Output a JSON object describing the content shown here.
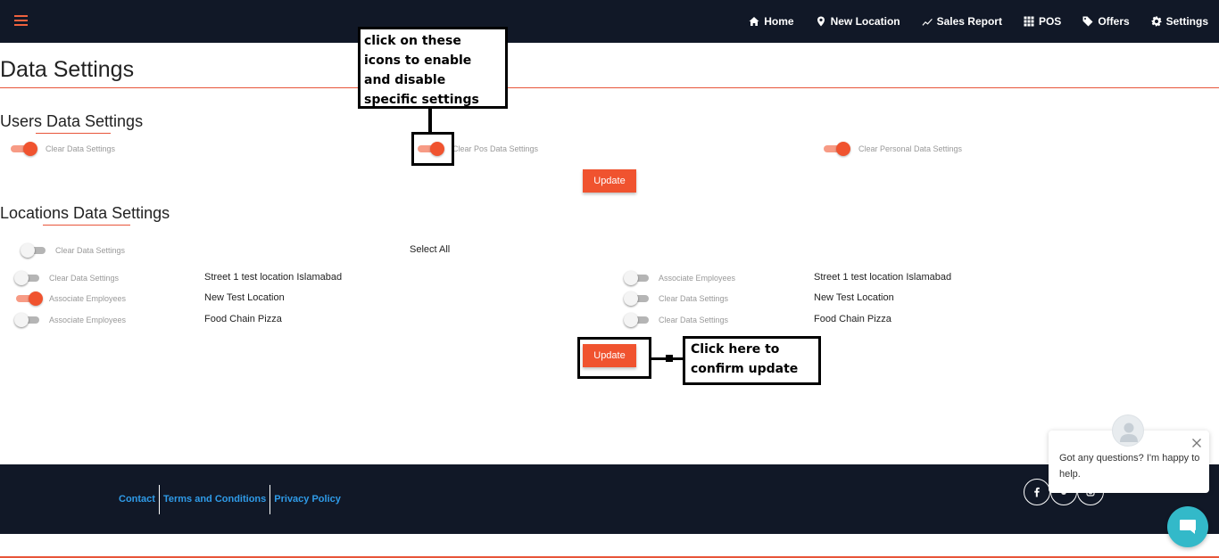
{
  "nav": {
    "items": [
      {
        "label": "Home",
        "icon": "home-icon"
      },
      {
        "label": "New Location",
        "icon": "map-pin-icon"
      },
      {
        "label": "Sales Report",
        "icon": "trend-line-icon"
      },
      {
        "label": "POS",
        "icon": "grid-icon"
      },
      {
        "label": "Offers",
        "icon": "tag-icon"
      },
      {
        "label": "Settings",
        "icon": "gear-icon"
      }
    ]
  },
  "page": {
    "title": "Data Settings"
  },
  "users_section": {
    "title": "Users Data Settings",
    "toggles": [
      {
        "label": "Clear Data Settings",
        "on": true
      },
      {
        "label": "Clear Pos Data Settings",
        "on": true
      },
      {
        "label": "Clear Personal Data Settings",
        "on": true
      }
    ],
    "update_label": "Update"
  },
  "locations_section": {
    "title": "Locations Data Settings",
    "master_toggle": {
      "label": "Clear Data Settings",
      "on": false
    },
    "select_all_label": "Select All",
    "left_rows": [
      {
        "label": "Clear Data Settings",
        "location": "Street 1 test location Islamabad",
        "on": false
      },
      {
        "label": "Associate Employees",
        "location": "New Test Location",
        "on": true
      },
      {
        "label": "Associate Employees",
        "location": "Food Chain Pizza",
        "on": false
      }
    ],
    "right_rows": [
      {
        "label": "Associate Employees",
        "location": "Street 1 test location Islamabad",
        "on": false
      },
      {
        "label": "Clear Data Settings",
        "location": "New Test Location",
        "on": false
      },
      {
        "label": "Clear Data Settings",
        "location": "Food Chain Pizza",
        "on": false
      }
    ],
    "update_label": "Update"
  },
  "annotations": {
    "toggle_hint": [
      "click on these",
      "icons to enable",
      "and disable",
      "specific settings"
    ],
    "update_hint": [
      "Click here to",
      "confirm update"
    ]
  },
  "footer": {
    "links": [
      "Contact",
      "Terms and Conditions",
      "Privacy Policy"
    ],
    "social_icons": [
      "facebook-icon",
      "twitter-icon",
      "instagram-icon"
    ]
  },
  "chat": {
    "message": "Got any questions? I'm happy to help."
  },
  "colors": {
    "accent": "#f0532f",
    "nav_bg": "#111827",
    "link": "#2f9be8",
    "chat": "#33b9c9"
  }
}
